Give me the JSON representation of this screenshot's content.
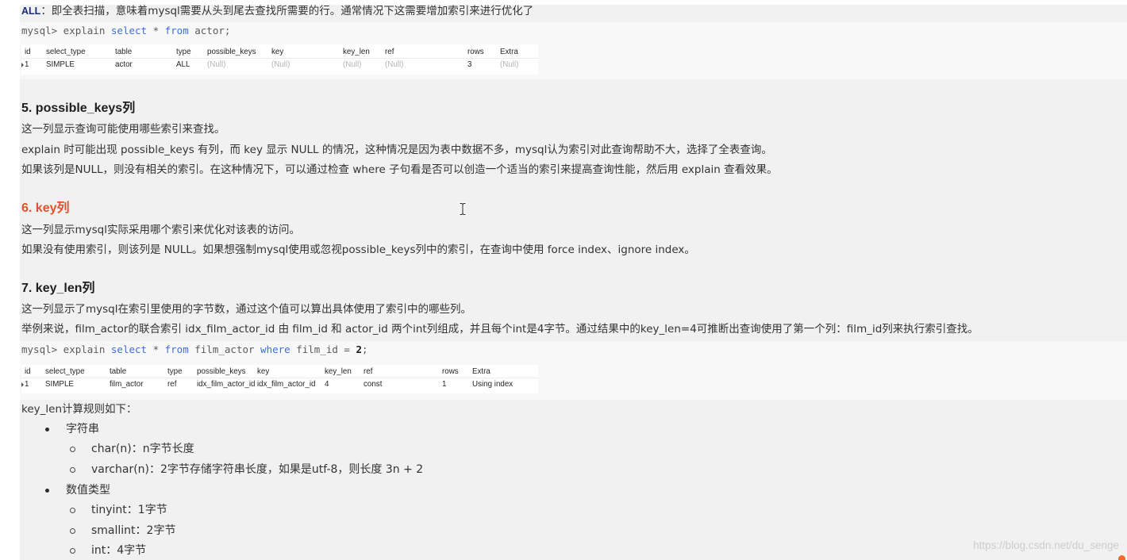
{
  "intro": {
    "term": "ALL",
    "text": "：即全表扫描，意味着mysql需要从头到尾去查找所需要的行。通常情况下这需要增加索引来进行优化了"
  },
  "code_1": {
    "prefix": "mysql> explain ",
    "kw_select": "select",
    "star": " * ",
    "kw_from": "from",
    "rest": " actor;"
  },
  "result_1": {
    "columns": [
      "id",
      "select_type",
      "table",
      "type",
      "possible_keys",
      "key",
      "key_len",
      "ref",
      "rows",
      "Extra"
    ],
    "rows": [
      [
        "1",
        "SIMPLE",
        "actor",
        "ALL",
        "(Null)",
        "(Null)",
        "(Null)",
        "(Null)",
        "3",
        "(Null)"
      ]
    ]
  },
  "sections": [
    {
      "heading": "5. possible_keys列",
      "paragraphs": [
        "这一列显示查询可能使用哪些索引来查找。",
        "explain 时可能出现 possible_keys 有列，而 key 显示 NULL 的情况，这种情况是因为表中数据不多，mysql认为索引对此查询帮助不大，选择了全表查询。",
        "如果该列是NULL，则没有相关的索引。在这种情况下，可以通过检查 where 子句看是否可以创造一个适当的索引来提高查询性能，然后用 explain 查看效果。"
      ]
    },
    {
      "heading": "6. key列",
      "paragraphs": [
        "这一列显示mysql实际采用哪个索引来优化对该表的访问。",
        "如果没有使用索引，则该列是 NULL。如果想强制mysql使用或忽视possible_keys列中的索引，在查询中使用 force index、ignore index。"
      ]
    },
    {
      "heading": "7. key_len列",
      "paragraphs": [
        "这一列显示了mysql在索引里使用的字节数，通过这个值可以算出具体使用了索引中的哪些列。",
        "举例来说，film_actor的联合索引 idx_film_actor_id 由 film_id 和 actor_id 两个int列组成，并且每个int是4字节。通过结果中的key_len=4可推断出查询使用了第一个列：film_id列来执行索引查找。"
      ]
    }
  ],
  "code_2": {
    "prefix": "mysql> explain ",
    "kw_select": "select",
    "star": " * ",
    "kw_from": "from",
    "table": " film_actor ",
    "kw_where": "where",
    "cond": " film_id = ",
    "value": "2",
    "end": ";"
  },
  "result_2": {
    "columns": [
      "id",
      "select_type",
      "table",
      "type",
      "possible_keys",
      "key",
      "key_len",
      "ref",
      "rows",
      "Extra"
    ],
    "rows": [
      [
        "1",
        "SIMPLE",
        "film_actor",
        "ref",
        "idx_film_actor_id",
        "idx_film_actor_id",
        "4",
        "const",
        "1",
        "Using index"
      ]
    ]
  },
  "key_len_rules": {
    "intro": "key_len计算规则如下：",
    "groups": [
      {
        "label": "字符串",
        "items": [
          "char(n)：n字节长度",
          "varchar(n)：2字节存储字符串长度，如果是utf-8，则长度 3n + 2"
        ]
      },
      {
        "label": "数值类型",
        "items": [
          "tinyint：1字节",
          "smallint：2字节",
          "int：4字节"
        ]
      }
    ]
  },
  "watermark": "https://blog.csdn.net/du_senge",
  "colors": {
    "text": "#333333",
    "heading": "#1e1e1e",
    "heading_accent": "#e0522b",
    "keyword": "#3f6fd1",
    "term": "#1c2a7a",
    "null_value": "#b3b3b3",
    "page_bg": "#f1f1f1",
    "code_bg": "#f8f8f8",
    "watermark": "#cdcdcd"
  },
  "icons": {
    "cursor": "text-cursor-icon",
    "bullet_level_1": "bullet-disc-icon",
    "bullet_level_2": "bullet-circle-icon",
    "row_indicator": "row-indicator-icon"
  }
}
